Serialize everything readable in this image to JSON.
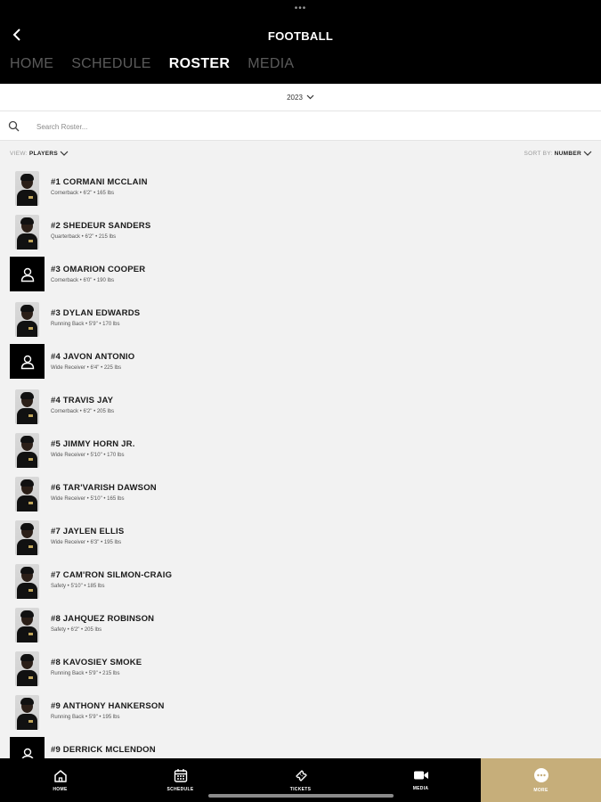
{
  "header": {
    "title": "FOOTBALL",
    "tabs": [
      {
        "label": "HOME",
        "active": false
      },
      {
        "label": "SCHEDULE",
        "active": false
      },
      {
        "label": "ROSTER",
        "active": true
      },
      {
        "label": "MEDIA",
        "active": false
      }
    ]
  },
  "season": {
    "selected": "2023"
  },
  "search": {
    "placeholder": "Search Roster..."
  },
  "filters": {
    "view_label": "VIEW:",
    "view_value": "PLAYERS",
    "sort_label": "SORT BY:",
    "sort_value": "NUMBER"
  },
  "players": [
    {
      "name": "#1 CORMANI MCCLAIN",
      "detail": "Cornerback • 6'2\" • 165 lbs",
      "photo": true
    },
    {
      "name": "#2 SHEDEUR SANDERS",
      "detail": "Quarterback • 6'2\" • 215 lbs",
      "photo": true
    },
    {
      "name": "#3 OMARION COOPER",
      "detail": "Cornerback • 6'0\" • 190 lbs",
      "photo": false
    },
    {
      "name": "#3 DYLAN EDWARDS",
      "detail": "Running Back • 5'9\" • 170 lbs",
      "photo": true
    },
    {
      "name": "#4 JAVON ANTONIO",
      "detail": "Wide Receiver • 6'4\" • 225 lbs",
      "photo": false
    },
    {
      "name": "#4 TRAVIS JAY",
      "detail": "Cornerback • 6'2\" • 205 lbs",
      "photo": true
    },
    {
      "name": "#5 JIMMY HORN JR.",
      "detail": "Wide Receiver • 5'10\" • 170 lbs",
      "photo": true
    },
    {
      "name": "#6 TAR'VARISH DAWSON",
      "detail": "Wide Receiver • 5'10\" • 165 lbs",
      "photo": true
    },
    {
      "name": "#7 JAYLEN ELLIS",
      "detail": "Wide Receiver • 6'3\" • 195 lbs",
      "photo": true
    },
    {
      "name": "#7 CAM'RON SILMON-CRAIG",
      "detail": "Safety • 5'10\" • 185 lbs",
      "photo": true
    },
    {
      "name": "#8 JAHQUEZ ROBINSON",
      "detail": "Safety • 6'2\" • 205 lbs",
      "photo": true
    },
    {
      "name": "#8 KAVOSIEY SMOKE",
      "detail": "Running Back • 5'9\" • 215 lbs",
      "photo": true
    },
    {
      "name": "#9 ANTHONY HANKERSON",
      "detail": "Running Back • 5'9\" • 195 lbs",
      "photo": true
    },
    {
      "name": "#9 DERRICK MCLENDON",
      "detail": "",
      "photo": false
    }
  ],
  "bottom_nav": [
    {
      "label": "HOME",
      "icon": "home-icon",
      "active": false
    },
    {
      "label": "SCHEDULE",
      "icon": "calendar-icon",
      "active": false
    },
    {
      "label": "TICKETS",
      "icon": "ticket-icon",
      "active": false
    },
    {
      "label": "MEDIA",
      "icon": "video-icon",
      "active": false
    },
    {
      "label": "MORE",
      "icon": "more-icon",
      "active": true
    }
  ],
  "colors": {
    "header_bg": "#000000",
    "active_nav_bg": "#c6ae7a",
    "page_bg": "#f2f2f2"
  }
}
